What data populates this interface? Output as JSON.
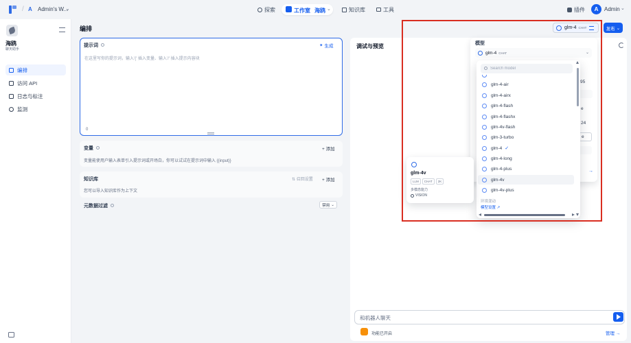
{
  "topbar": {
    "workspace_initial": "A",
    "workspace_name": "Admin's W...",
    "nav": {
      "explore": "探索",
      "studio": "工作室",
      "current_app": "海鸥",
      "knowledge": "知识库",
      "tools": "工具",
      "plugins": "插件"
    },
    "user_initial": "A",
    "user_name": "Admin"
  },
  "sidebar": {
    "app_name": "海鸥",
    "app_type": "聊天助手",
    "items": [
      {
        "label": "编排",
        "active": true
      },
      {
        "label": "访问 API",
        "active": false
      },
      {
        "label": "日志与标注",
        "active": false
      },
      {
        "label": "监测",
        "active": false
      }
    ]
  },
  "orchestrate": {
    "title": "编排",
    "prompt": {
      "label": "提示词",
      "generate": "生成",
      "placeholder": "在这里写你的提示词，输入'{' 插入变量、输入'/' 插入提示内容块",
      "count": "0"
    },
    "variables": {
      "title": "变量",
      "add": "添加",
      "desc": "变量能使用户输入表单引入提示词或开场白，你可以试试在提示词中输入 {{input}}"
    },
    "knowledge": {
      "title": "知识库",
      "recall": "召回设置",
      "add": "添加",
      "desc": "您可以导入知识库作为上下文"
    },
    "metadata": {
      "title": "元数据过滤",
      "value": "禁用"
    }
  },
  "debug": {
    "title": "调试与预览",
    "chat_placeholder": "和机器人聊天",
    "feature_text": "功能已开启",
    "manage": "管理"
  },
  "model_trigger": {
    "name": "glm-4",
    "tag": "CHAT"
  },
  "publish_label": "发布",
  "settings": {
    "label": "模型",
    "selected_name": "glm-4",
    "selected_tag": "CHAT",
    "param_fragments": [
      "95",
      "e",
      "24",
      "e"
    ]
  },
  "model_list": {
    "search_placeholder": "Search model",
    "options": [
      {
        "name": "glm-4-air",
        "selected": false,
        "hover": false
      },
      {
        "name": "glm-4-airx",
        "selected": false,
        "hover": false
      },
      {
        "name": "glm-4-flash",
        "selected": false,
        "hover": false
      },
      {
        "name": "glm-4-flashx",
        "selected": false,
        "hover": false
      },
      {
        "name": "glm-4v-flash",
        "selected": false,
        "hover": false
      },
      {
        "name": "glm-3-turbo",
        "selected": false,
        "hover": false
      },
      {
        "name": "glm-4",
        "selected": true,
        "hover": false
      },
      {
        "name": "glm-4-long",
        "selected": false,
        "hover": false
      },
      {
        "name": "glm-4-plus",
        "selected": false,
        "hover": false
      },
      {
        "name": "glm-4v",
        "selected": false,
        "hover": true
      },
      {
        "name": "glm-4v-plus",
        "selected": false,
        "hover": false
      }
    ],
    "footer_hint": "环境混动",
    "footer_link": "模型设置"
  },
  "model_card": {
    "name": "glm-4v",
    "tags": [
      "LLM",
      "CHAT",
      "2K"
    ],
    "capability": "多模态能力",
    "vision": "VISION"
  },
  "colors": {
    "accent": "#155eef",
    "highlight": "#d92d20",
    "feature": "#f79009"
  }
}
